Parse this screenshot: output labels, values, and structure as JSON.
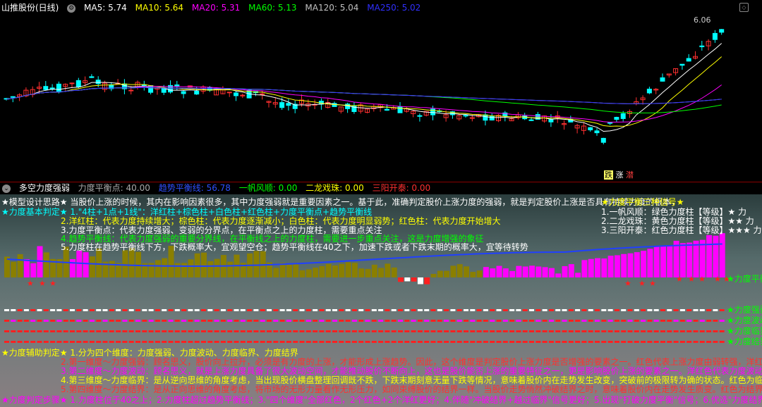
{
  "main_header": {
    "title": "山推股份(日线)",
    "ma5": "MA5: 5.74",
    "ma10": "MA10: 5.64",
    "ma20": "MA20: 5.31",
    "ma60": "MA60: 5.13",
    "ma120": "MA120: 5.04",
    "ma250": "MA250: 5.02",
    "colors": {
      "ma5": "#ffffff",
      "ma10": "#ffff00",
      "ma20": "#ff00ff",
      "ma60": "#00ff00",
      "ma120": "#c0c0c0",
      "ma250": "#0000ff"
    }
  },
  "price_labels": {
    "high": "6.06",
    "low_tags": [
      "跌",
      "涨",
      "潜"
    ]
  },
  "sub_header": {
    "title": "多空力度强弱",
    "p1": "力度平衡点: 40.00",
    "p2": "趋势平衡线: 56.78",
    "p3": "一帆风顺: 0.00",
    "p4": "二龙戏珠: 0.00",
    "p5": "三阳开泰: 0.00"
  },
  "info": {
    "line1": "★模型设计思路★ 当股价上涨的时候，其内在影响因素很多，其中力度强弱就是重要因素之一。基于此，准确判定股价上涨力度的强弱，就是判定股价上涨是否具有持续力度的根本，",
    "line2": "★力度基本判定★ 1.\"4柱+1点+1线\"：洋红柱+棕色柱+白色柱+红色柱+力度平衡点+趋势平衡线",
    "line3": "2.洋红柱：代表力度持续增大；棕色柱：代表力度逐渐减小；白色柱：代表力度明显弱势；红色柱：代表力度开始增大",
    "line4": "3.力度平衡点：代表力度强弱、变弱的分界点，在平衡点之上的力度柱，需要重点关注",
    "line5": "4.趋势平衡线：代表力度强弱的重要分界线，在平衡线之上的力度柱，需要进一步重点关注，这是力度增强的象征",
    "line6": "5.力度柱在趋势平衡线下方，下跌概率大，宜观望空仓；趋势平衡线在40之下，加速下跌或者下跌末期的概率大，宜等待转势",
    "signal_title": "★力度平衡三种信号★",
    "sig1": "1.一帆风顺：绿色力度柱【等级】★   力",
    "sig2": "2.二龙戏珠：黄色力度柱【等级】★★ 力",
    "sig3": "3.三阳开泰：红色力度柱【等级】★★★ 力"
  },
  "legend_right": {
    "l1": "★力度平衡",
    "l2": "★力度强弱",
    "l3": "★力度波动",
    "l4": "★力度临界",
    "l5": "★力度结界"
  },
  "aux": {
    "a1": "★力度辅助判定★ 1.分为四个维度：力度强弱、力度波动、力度临界、力度结界",
    "a2": "2.第一维度～力度强弱：顾名思义，股价向上拉升，必须是有力度的上涨，才能形成上涨趋势。因此，这个维度是判定股价上涨力度是否增强的要素之一。红色代表上涨力度由弱转强，洋红",
    "a3": "3.第二维度～力度波动：顾名思义，就是上涨力度具备了很大波动空间，才能推动股价不断向上，这也是股价能否上涨的重要特征之一，更是影响股价上涨的要素之一。洋红色代表力度波动",
    "a4": "4.第三维度～力度临界：是从逆向思维的角度考虑，当出现股价横盘整理回调既不跌，下跌末期刻意无量下跌等情况，意味着股价内在走势发生改变，突破前的极限转为确的状态。红色为临界",
    "a5": "5.第四维度～力度结界：是从正向思维的角度考虑，将市场的无形力量看作无形压力，如同束缚股价的结界一样。当股价走势悄然冲破结界之时，意味着股价内在走势发生质变。红色为结界",
    "steps": "★力度判定步骤★ 1.力度柱位于40之上；2.力度柱超过趋势平衡线；3.\"四个维度\"全部红色，2个红色+2个洋红更好；4.伴随\"冲破结界+越过临界\"信号更好；5.出现\"打破力度平衡\"信号；6.优选\"力度结界\"突破"
  },
  "chart_data": [
    {
      "type": "candlestick",
      "title": "山推股份(日线)",
      "labeled_high": 6.06,
      "series": [
        {
          "name": "MA5",
          "value": 5.74
        },
        {
          "name": "MA10",
          "value": 5.64
        },
        {
          "name": "MA20",
          "value": 5.31
        },
        {
          "name": "MA60",
          "value": 5.13
        },
        {
          "name": "MA120",
          "value": 5.04
        },
        {
          "name": "MA250",
          "value": 5.02
        }
      ]
    },
    {
      "type": "bar",
      "title": "多空力度强弱",
      "reference_lines": [
        {
          "name": "力度平衡点",
          "value": 40.0
        },
        {
          "name": "趋势平衡线",
          "value": 56.78
        }
      ],
      "signals": [
        {
          "name": "一帆风顺",
          "value": 0.0
        },
        {
          "name": "二龙戏珠",
          "value": 0.0
        },
        {
          "name": "三阳开泰",
          "value": 0.0
        }
      ]
    }
  ]
}
